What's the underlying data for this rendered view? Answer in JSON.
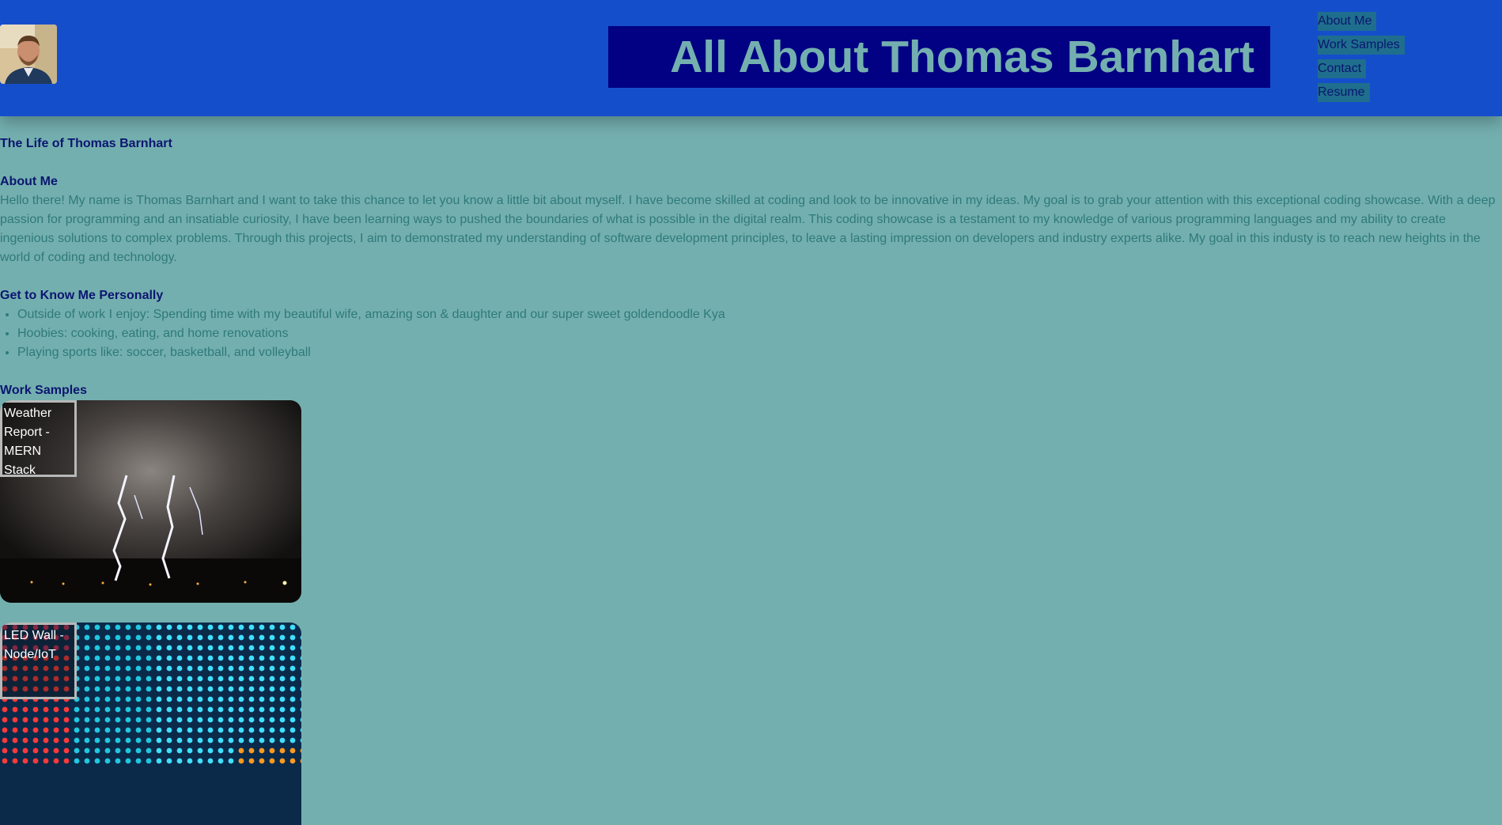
{
  "header": {
    "title": "All About Thomas Barnhart",
    "nav": [
      "About Me",
      "Work Samples",
      "Contact",
      "Resume"
    ]
  },
  "main": {
    "heading": "The Life of Thomas Barnhart",
    "about": {
      "heading": "About Me",
      "text": "Hello there! My name is Thomas Barnhart and I want to take this chance to let you know a little bit about myself. I have become skilled at coding and look to be innovative in my ideas. My goal is to grab your attention with this exceptional coding showcase. With a deep passion for programming and an insatiable curiosity, I have been learning ways to pushed the boundaries of what is possible in the digital realm. This coding showcase is a testament to my knowledge of various programming languages and my ability to create ingenious solutions to complex problems. Through this projects, I aim to demonstrated my understanding of software development principles, to leave a lasting impression on developers and industry experts alike. My goal in this industy is to reach new heights in the world of coding and technology."
    },
    "personal": {
      "heading": "Get to Know Me Personally",
      "items": [
        "Outside of work I enjoy: Spending time with my beautiful wife, amazing son & daughter and our super sweet goldendoodle Kya",
        "Hoobies: cooking, eating, and home renovations",
        "Playing sports like: soccer, basketball, and volleyball"
      ]
    },
    "work": {
      "heading": "Work Samples",
      "cards": [
        {
          "label": "Weather Report - MERN Stack",
          "image": "lightning-storm"
        },
        {
          "label": "LED Wall - Node/IoT",
          "image": "led-wall"
        }
      ]
    }
  }
}
